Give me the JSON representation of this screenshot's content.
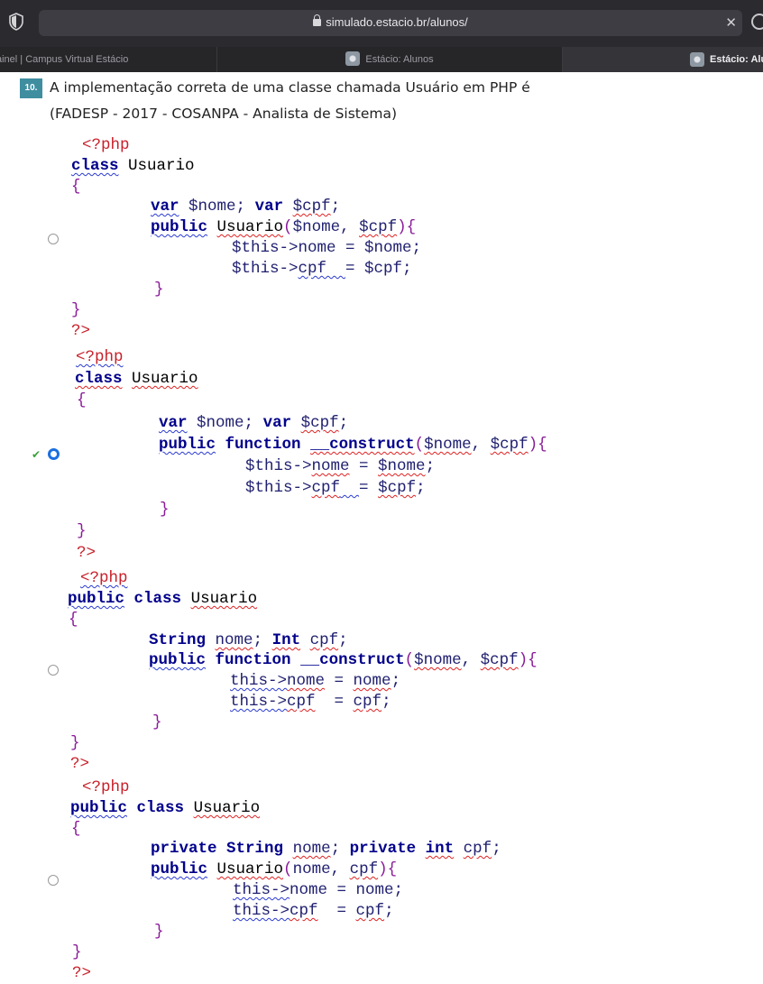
{
  "browser": {
    "url": "simulado.estacio.br/alunos/",
    "tabs": [
      {
        "label": "ainel | Campus Virtual Estácio"
      },
      {
        "label": "Estácio: Alunos"
      },
      {
        "label": "Estácio: Alu"
      }
    ]
  },
  "question": {
    "number": "10.",
    "text": "A implementação correta de uma classe chamada Usuário em PHP é",
    "source": "(FADESP - 2017 - COSANPA - Analista de Sistema)"
  },
  "options": [
    {
      "selected": false,
      "correct": false,
      "lines": [
        "<?php",
        "class Usuario",
        "{",
        "var $nome; var $cpf;",
        "public Usuario($nome, $cpf){",
        "$this->nome = $nome;",
        "$this->cpf  = $cpf;",
        "}",
        "}",
        "?>"
      ]
    },
    {
      "selected": true,
      "correct": true,
      "lines": [
        "<?php",
        "class Usuario",
        "{",
        "var $nome; var $cpf;",
        "public function __construct($nome, $cpf){",
        "$this->nome = $nome;",
        "$this->cpf  = $cpf;",
        "}",
        "}",
        "?>"
      ]
    },
    {
      "selected": false,
      "correct": false,
      "lines": [
        "<?php",
        "public class Usuario",
        "{",
        "String nome; Int cpf;",
        "public function __construct($nome, $cpf){",
        "this->nome = nome;",
        "this->cpf  = cpf;",
        "}",
        "}",
        "?>"
      ]
    },
    {
      "selected": false,
      "correct": false,
      "lines": [
        "<?php",
        "public class Usuario",
        "{",
        "private String nome; private int cpf;",
        "public Usuario(nome, cpf){",
        "this->nome = nome;",
        "this->cpf  = cpf;",
        "}",
        "}",
        "?>"
      ]
    }
  ],
  "icons": {
    "shield": "shield-icon",
    "lock": "lock-icon",
    "clear": "close-icon",
    "check": "checkmark-icon"
  },
  "colors": {
    "keyword": "#00008b",
    "bracket": "#8a1a99",
    "php_tag": "#c8202a",
    "question_badge": "#3f8ea0",
    "selected_radio": "#1a6fe0"
  }
}
